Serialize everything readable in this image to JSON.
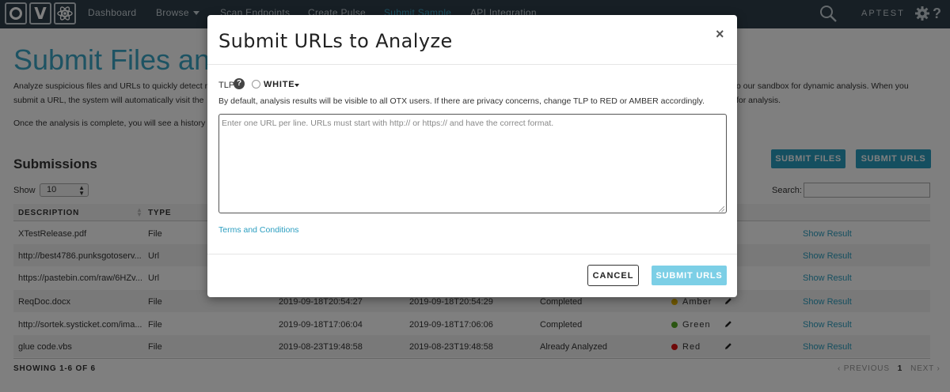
{
  "nav": {
    "logo_letter": "V",
    "items": [
      {
        "label": "Dashboard"
      },
      {
        "label": "Browse"
      },
      {
        "label": "Scan Endpoints"
      },
      {
        "label": "Create Pulse"
      },
      {
        "label": "Submit Sample"
      },
      {
        "label": "API Integration"
      }
    ],
    "active": "Submit Sample",
    "user": "APTEST"
  },
  "page": {
    "title": "Submit Files and",
    "intro_line1": "Analyze suspicious files and URLs to quickly detect m",
    "intro_line1_end": "o our sandbox for dynamic analysis. When you",
    "intro_line2": "submit a URL, the system will automatically visit the",
    "intro_line2_end": "for analysis.",
    "intro_line3": "Once the analysis is complete, you will see a history o",
    "submissions_title": "Submissions",
    "submit_files_label": "SUBMIT FILES",
    "submit_urls_label": "SUBMIT URLS",
    "show_label": "Show",
    "show_value": "10",
    "search_label": "Search:"
  },
  "table": {
    "columns": [
      "DESCRIPTION",
      "TYPE"
    ],
    "rows": [
      {
        "description": "XTestRelease.pdf",
        "type": "File",
        "submitted": "",
        "completed": "",
        "status": "",
        "tlp": "",
        "result": "Show Result"
      },
      {
        "description": "http://best4786.punksgotoserv...",
        "type": "Url",
        "submitted": "",
        "completed": "",
        "status": "",
        "tlp": "",
        "result": "Show Result"
      },
      {
        "description": "https://pastebin.com/raw/6HZv...",
        "type": "Url",
        "submitted": "",
        "completed": "",
        "status": "",
        "tlp": "",
        "result": "Show Result"
      },
      {
        "description": "ReqDoc.docx",
        "type": "File",
        "submitted": "2019-09-18T20:54:27",
        "completed": "2019-09-18T20:54:29",
        "status": "Completed",
        "tlp": "Amber",
        "result": "Show Result"
      },
      {
        "description": "http://sortek.systicket.com/ima...",
        "type": "File",
        "submitted": "2019-09-18T17:06:04",
        "completed": "2019-09-18T17:06:06",
        "status": "Completed",
        "tlp": "Green",
        "result": "Show Result"
      },
      {
        "description": "glue code.vbs",
        "type": "File",
        "submitted": "2019-08-23T19:48:58",
        "completed": "2019-08-23T19:48:58",
        "status": "Already Analyzed",
        "tlp": "Red",
        "result": "Show Result"
      }
    ],
    "tlp_colors": {
      "Amber": "#e0b000",
      "Green": "#55aa22",
      "Red": "#dd1111"
    },
    "showing": "SHOWING 1-6 OF 6",
    "pager_prev": "‹ PREVIOUS",
    "pager_current": "1",
    "pager_next": "NEXT ›"
  },
  "modal": {
    "title": "Submit URLs to Analyze",
    "close_glyph": "×",
    "tlp_label": "TLP",
    "tlp_help": "?",
    "tlp_value": "WHITE",
    "tlp_hint": "By default, analysis results will be visible to all OTX users. If there are privacy concerns, change TLP to RED or AMBER accordingly.",
    "url_placeholder": "Enter one URL per line. URLs must start with http:// or https:// and have the correct format.",
    "terms_label": "Terms and Conditions",
    "cancel_label": "CANCEL",
    "submit_label": "SUBMIT URLS"
  },
  "colors": {
    "accent": "#2b9ec0",
    "nav_bg": "#2e3e4a",
    "submit_disabled": "#7ccfe6"
  }
}
